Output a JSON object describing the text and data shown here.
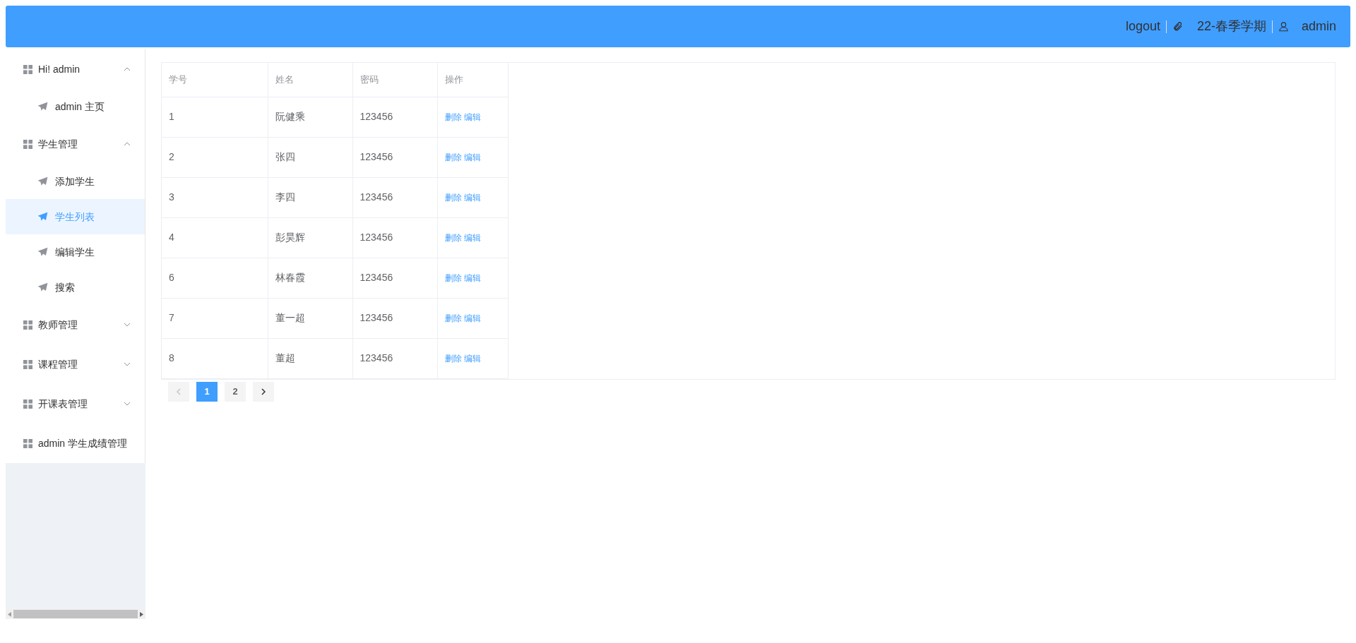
{
  "header": {
    "logout": "logout",
    "term": "22-春季学期",
    "user": "admin"
  },
  "sidebar": {
    "groups": [
      {
        "label": "Hi! admin",
        "kind": "submenu",
        "expanded": true,
        "children": [
          {
            "label": "admin 主页",
            "selected": false
          }
        ]
      },
      {
        "label": "学生管理",
        "kind": "submenu",
        "expanded": true,
        "children": [
          {
            "label": "添加学生",
            "selected": false
          },
          {
            "label": "学生列表",
            "selected": true
          },
          {
            "label": "编辑学生",
            "selected": false
          },
          {
            "label": "搜索",
            "selected": false
          }
        ]
      },
      {
        "label": "教师管理",
        "kind": "submenu",
        "expanded": false
      },
      {
        "label": "课程管理",
        "kind": "submenu",
        "expanded": false
      },
      {
        "label": "开课表管理",
        "kind": "submenu",
        "expanded": false
      },
      {
        "label": "admin 学生成绩管理",
        "kind": "item"
      }
    ]
  },
  "table": {
    "columns": [
      "学号",
      "姓名",
      "密码",
      "操作"
    ],
    "rows": [
      {
        "id": "1",
        "name": "阮健乘",
        "password": "123456",
        "actions": [
          "删除",
          "编辑"
        ]
      },
      {
        "id": "2",
        "name": "张四",
        "password": "123456",
        "actions": [
          "删除",
          "编辑"
        ]
      },
      {
        "id": "3",
        "name": "李四",
        "password": "123456",
        "actions": [
          "删除",
          "编辑"
        ]
      },
      {
        "id": "4",
        "name": "彭昊辉",
        "password": "123456",
        "actions": [
          "删除",
          "编辑"
        ]
      },
      {
        "id": "6",
        "name": "林春霞",
        "password": "123456",
        "actions": [
          "删除",
          "编辑"
        ]
      },
      {
        "id": "7",
        "name": "董一超",
        "password": "123456",
        "actions": [
          "删除",
          "编辑"
        ]
      },
      {
        "id": "8",
        "name": "董超",
        "password": "123456",
        "actions": [
          "删除",
          "编辑"
        ]
      }
    ]
  },
  "pagination": {
    "prev_disabled": true,
    "next_disabled": false,
    "pages": [
      {
        "label": "1",
        "selected": true
      },
      {
        "label": "2",
        "selected": false
      }
    ]
  }
}
